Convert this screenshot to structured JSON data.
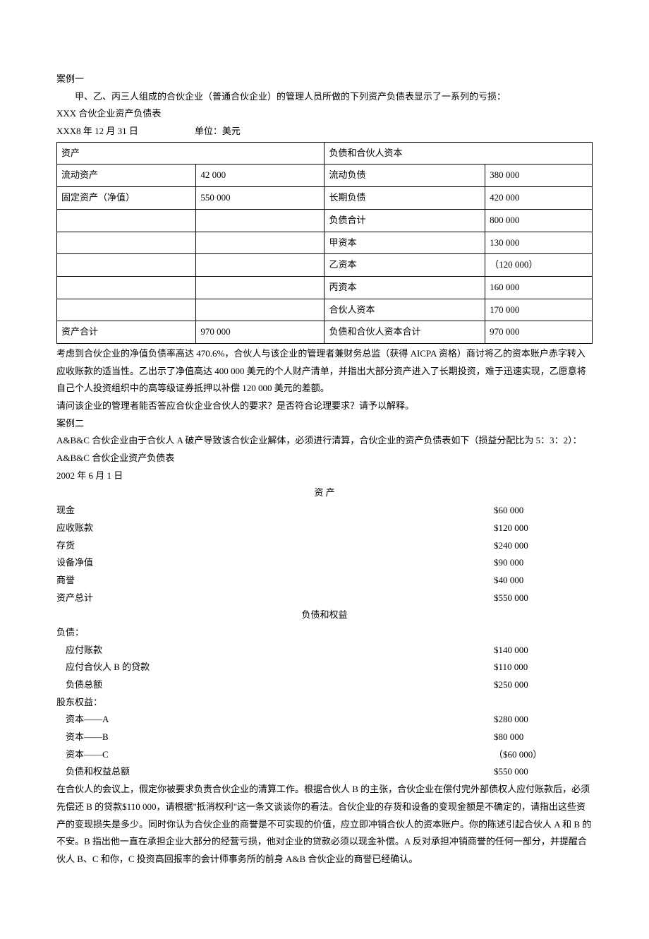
{
  "case1": {
    "title": "案例一",
    "intro": "甲、乙、丙三人组成的合伙企业（普通合伙企业）的管理人员所做的下列资产负债表显示了一系列的亏损：",
    "tableTitle": "XXX 合伙企业资产负债表",
    "date": "XXX8 年 12 月 31 日",
    "unit": "单位：美元",
    "headers": {
      "assets": "资产",
      "liabEquity": "负债和合伙人资本"
    },
    "rows": [
      {
        "a": "流动资产",
        "av": "42 000",
        "l": "流动负债",
        "lv": "380 000"
      },
      {
        "a": "固定资产（净值）",
        "av": "550 000",
        "l": "长期负债",
        "lv": "420 000"
      },
      {
        "a": "",
        "av": "",
        "l": "负债合计",
        "lv": "800 000"
      },
      {
        "a": "",
        "av": "",
        "l": "甲资本",
        "lv": "130 000"
      },
      {
        "a": "",
        "av": "",
        "l": "乙资本",
        "lv": "（120 000）"
      },
      {
        "a": "",
        "av": "",
        "l": "丙资本",
        "lv": "160 000"
      },
      {
        "a": "",
        "av": "",
        "l": "合伙人资本",
        "lv": "170 000"
      },
      {
        "a": "资产合计",
        "av": "970 000",
        "l": "负债和合伙人资本合计",
        "lv": "970 000"
      }
    ],
    "p1": "考虑到合伙企业的净值负债率高达 470.6%，合伙人与该企业的管理者兼财务总监（获得 AICPA 资格）商讨将乙的资本账户赤字转入应收账款的适当性。乙出示了净值高达 400 000 美元的个人财产清单，并指出大部分资产进入了长期投资，难于迅速实现，乙愿意将自己个人投资组织中的高等级证券抵押以补偿 120 000 美元的差额。",
    "p2": "请问该企业的管理者能否答应合伙企业合伙人的要求？是否符合论理要求？请予以解释。"
  },
  "case2": {
    "title": "案例二",
    "intro": "A&B&C 合伙企业由于合伙人 A 破产导致该合伙企业解体，必须进行清算，合伙企业的资产负债表如下（损益分配比为 5：3：2）：",
    "tableTitle": "A&B&C 合伙企业资产负债表",
    "date": "2002 年 6 月 1 日",
    "assetHeader": "资  产",
    "assets": [
      {
        "label": "现金",
        "value": "$60 000"
      },
      {
        "label": "应收账款",
        "value": "$120 000"
      },
      {
        "label": "存货",
        "value": "$240 000"
      },
      {
        "label": "设备净值",
        "value": "$90 000"
      },
      {
        "label": "商誉",
        "value": "$40 000"
      },
      {
        "label": "资产总计",
        "value": "$550 000"
      }
    ],
    "liabHeader": "负债和权益",
    "liabLabel": "负债：",
    "liabilities": [
      {
        "label": "应付账款",
        "value": "$140 000"
      },
      {
        "label": "应付合伙人 B 的贷款",
        "value": "$110 000"
      },
      {
        "label": "负债总额",
        "value": "$250 000"
      }
    ],
    "equityLabel": "股东权益：",
    "equity": [
      {
        "label": "资本——A",
        "value": "$280 000"
      },
      {
        "label": "资本——B",
        "value": "$80 000"
      },
      {
        "label": "资本——C",
        "value": "（$60 000）"
      },
      {
        "label": "负债和权益总额",
        "value": "$550 000"
      }
    ],
    "p1": "在合伙人的会议上，假定你被要求负责合伙企业的清算工作。根据合伙人 B 的主张，合伙企业在偿付完外部债权人应付账款后，必须先偿还 B 的贷款$110 000，请根据\"抵消权利\"这一条文谈谈你的看法。合伙企业的存货和设备的变现金额是不确定的，请指出这些资产的变现损失是多少。同时你认为合伙企业的商誉是不可实现的价值，应立即冲销合伙人的资本账户。你的陈述引起合伙人 A 和 B 的不安。B 指出他一直在承担企业大部分的经营亏损，他对企业的贷款必须以现金补偿。A 反对承担冲销商誉的任何一部分，并提醒合伙人 B、C 和你，C 投资高回报率的会计师事务所的前身 A&B 合伙企业的商誉已经确认。"
  }
}
